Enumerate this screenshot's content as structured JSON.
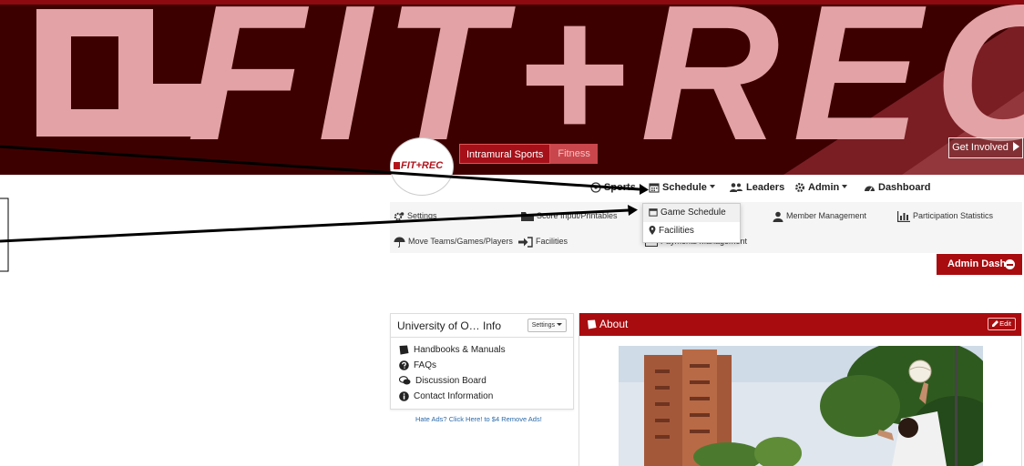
{
  "banner": {
    "wordmark": "FIT+REC",
    "get_involved": "Get Involved",
    "tabs": {
      "intramural": "Intramural Sports",
      "fitness": "Fitness"
    },
    "logo_text": "FIT+REC"
  },
  "nav": {
    "sports": "Sports",
    "schedule": "Schedule",
    "leaders": "Leaders",
    "admin": "Admin",
    "dashboard": "Dashboard"
  },
  "schedule_dropdown": {
    "items": [
      {
        "label": "Game Schedule",
        "icon": "calendar-icon"
      },
      {
        "label": "Facilities",
        "icon": "map-marker-icon"
      }
    ]
  },
  "admin_bar": {
    "settings": "Settings",
    "score_import": "Score Input/Printables",
    "member_management": "Member Management",
    "participation_statistics": "Participation Statistics",
    "move_teams": "Move Teams/Games/Players",
    "facilities": "Facilities",
    "payments_management": "Payments Management"
  },
  "admin_dash": {
    "label": "Admin Dash"
  },
  "info": {
    "title": "University of O… Info",
    "settings": "Settings",
    "items": [
      {
        "label": "Handbooks & Manuals",
        "icon": "book-icon"
      },
      {
        "label": "FAQs",
        "icon": "question-circle-icon"
      },
      {
        "label": "Discussion Board",
        "icon": "comments-icon"
      },
      {
        "label": "Contact Information",
        "icon": "info-circle-icon"
      }
    ],
    "hate_ads": "Hate Ads? Click Here! to $4 Remove Ads!"
  },
  "about": {
    "title": "About",
    "edit": "Edit"
  },
  "colors": {
    "brand_red": "#a90c0f",
    "banner_dark": "#3d0000",
    "wordmark_pink": "#e3a3a6"
  }
}
